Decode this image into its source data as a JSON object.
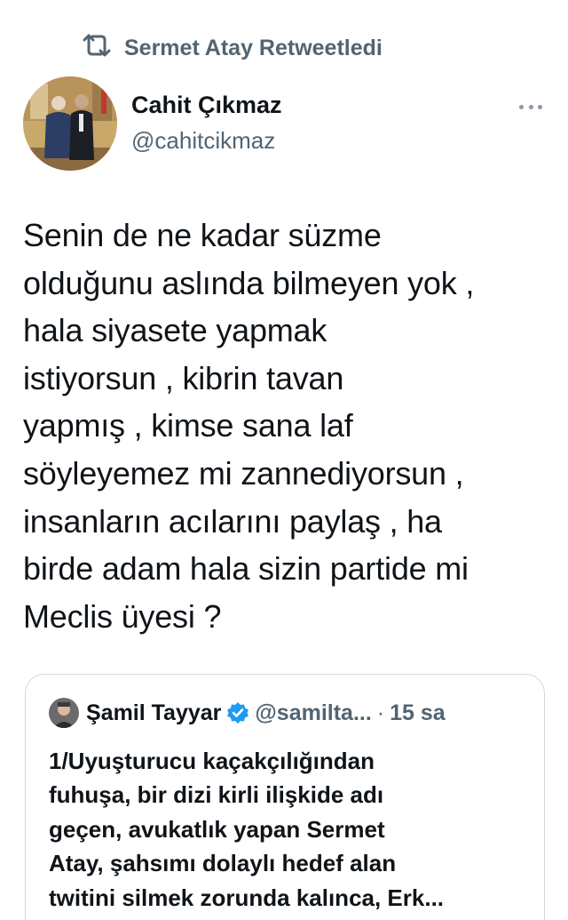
{
  "retweet": {
    "icon": "retweet-icon",
    "label": "Sermet Atay Retweetledi"
  },
  "tweet": {
    "author_name": "Cahit Çıkmaz",
    "author_handle": "@cahitcikmaz",
    "more_icon": "more-dots-icon",
    "text": "Senin de ne kadar süzme\nolduğunu aslında bilmeyen yok ,\nhala siyasete yapmak\nistiyorsun , kibrin tavan\nyapmış , kimse sana laf\nsöyleyemez mi zannediyorsun ,\ninsanların acılarını paylaş , ha\nbirde adam hala sizin partide mi\nMeclis üyesi ?"
  },
  "quote": {
    "author_name": "Şamil Tayyar",
    "verified_icon": "verified-badge-icon",
    "author_handle": "@samilta...",
    "separator": "·",
    "time": "15 sa",
    "text": "1/Uyuşturucu kaçakçılığından\nfuhuşa, bir dizi kirli ilişkide adı\ngeçen, avukatlık yapan Sermet\nAtay, şahsımı dolaylı hedef alan\ntwitini silmek zorunda kalınca, Erk..."
  },
  "colors": {
    "text_primary": "#0f1419",
    "text_secondary": "#536471",
    "border": "#cfd9de",
    "verified_blue": "#1d9bf0"
  }
}
